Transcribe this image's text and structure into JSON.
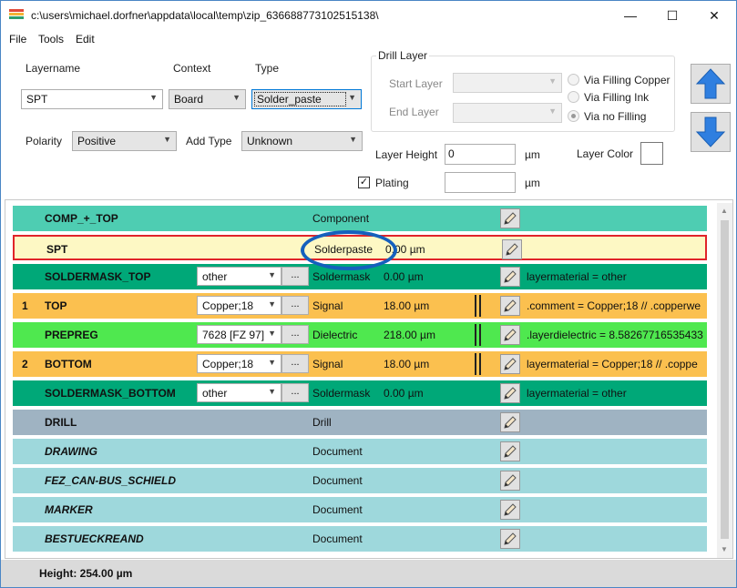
{
  "window": {
    "title": "c:\\users\\michael.dorfner\\appdata\\local\\temp\\zip_636688773102515138\\",
    "minimize": "—",
    "maximize": "☐",
    "close": "✕"
  },
  "menu": [
    "File",
    "Tools",
    "Edit"
  ],
  "form": {
    "layername_label": "Layername",
    "context_label": "Context",
    "type_label": "Type",
    "layername_value": "SPT",
    "context_value": "Board",
    "type_value": "Solder_paste",
    "polarity_label": "Polarity",
    "polarity_value": "Positive",
    "addtype_label": "Add Type",
    "addtype_value": "Unknown",
    "drill_group_title": "Drill Layer",
    "start_layer_label": "Start Layer",
    "end_layer_label": "End Layer",
    "via_options": [
      "Via Filling Copper",
      "Via Filling Ink",
      "Via no Filling"
    ],
    "via_selected": 2,
    "layer_height_label": "Layer Height",
    "layer_height_value": "0",
    "unit": "µm",
    "plating_label": "Plating",
    "plating_checked": true,
    "plating_value": "",
    "layer_color_label": "Layer Color",
    "layer_color": "#ffffff"
  },
  "colors": {
    "component": "#4ecdb2",
    "solderpaste": "#fdf8c4",
    "soldermask": "#00a878",
    "signal": "#fbc04f",
    "dielectric": "#4fe84f",
    "drill": "#9fb3c2",
    "document": "#9ed8dc",
    "selected_border": "#e0242a",
    "annotation": "#1560bd"
  },
  "rows": [
    {
      "num": "",
      "name": "COMP_+_TOP",
      "italic": false,
      "material": null,
      "context": "Component",
      "thickness": "",
      "note": "",
      "bar": false,
      "color": "component"
    },
    {
      "num": "",
      "name": "SPT",
      "italic": false,
      "material": null,
      "context": "Solderpaste",
      "thickness": "0.00 µm",
      "note": "",
      "bar": false,
      "color": "solderpaste",
      "selected": true
    },
    {
      "num": "",
      "name": "SOLDERMASK_TOP",
      "italic": false,
      "material": "other",
      "context": "Soldermask",
      "thickness": "0.00 µm",
      "note": "layermaterial = other",
      "bar": false,
      "color": "soldermask"
    },
    {
      "num": "1",
      "name": "TOP",
      "italic": false,
      "material": "Copper;18",
      "context": "Signal",
      "thickness": "18.00 µm",
      "note": ".comment = Copper;18 // .copperwe",
      "bar": true,
      "color": "signal"
    },
    {
      "num": "",
      "name": "PREPREG",
      "italic": false,
      "material": "7628 [FZ 97]",
      "context": "Dielectric",
      "thickness": "218.00 µm",
      "note": ".layerdielectric = 8.58267716535433",
      "bar": true,
      "color": "dielectric"
    },
    {
      "num": "2",
      "name": "BOTTOM",
      "italic": false,
      "material": "Copper;18",
      "context": "Signal",
      "thickness": "18.00 µm",
      "note": "layermaterial = Copper;18 // .coppe",
      "bar": true,
      "color": "signal"
    },
    {
      "num": "",
      "name": "SOLDERMASK_BOTTOM",
      "italic": false,
      "material": "other",
      "context": "Soldermask",
      "thickness": "0.00 µm",
      "note": "layermaterial = other",
      "bar": false,
      "color": "soldermask"
    },
    {
      "num": "",
      "name": "DRILL",
      "italic": false,
      "material": null,
      "context": "Drill",
      "thickness": "",
      "note": "",
      "bar": false,
      "color": "drill"
    },
    {
      "num": "",
      "name": "DRAWING",
      "italic": true,
      "material": null,
      "context": "Document",
      "thickness": "",
      "note": "",
      "bar": false,
      "color": "document"
    },
    {
      "num": "",
      "name": "FEZ_CAN-BUS_SCHIELD",
      "italic": true,
      "material": null,
      "context": "Document",
      "thickness": "",
      "note": "",
      "bar": false,
      "color": "document"
    },
    {
      "num": "",
      "name": "MARKER",
      "italic": true,
      "material": null,
      "context": "Document",
      "thickness": "",
      "note": "",
      "bar": false,
      "color": "document"
    },
    {
      "num": "",
      "name": "BESTUECKREAND",
      "italic": true,
      "material": null,
      "context": "Document",
      "thickness": "",
      "note": "",
      "bar": false,
      "color": "document"
    }
  ],
  "dots_label": "...",
  "status": "Height: 254.00 µm"
}
